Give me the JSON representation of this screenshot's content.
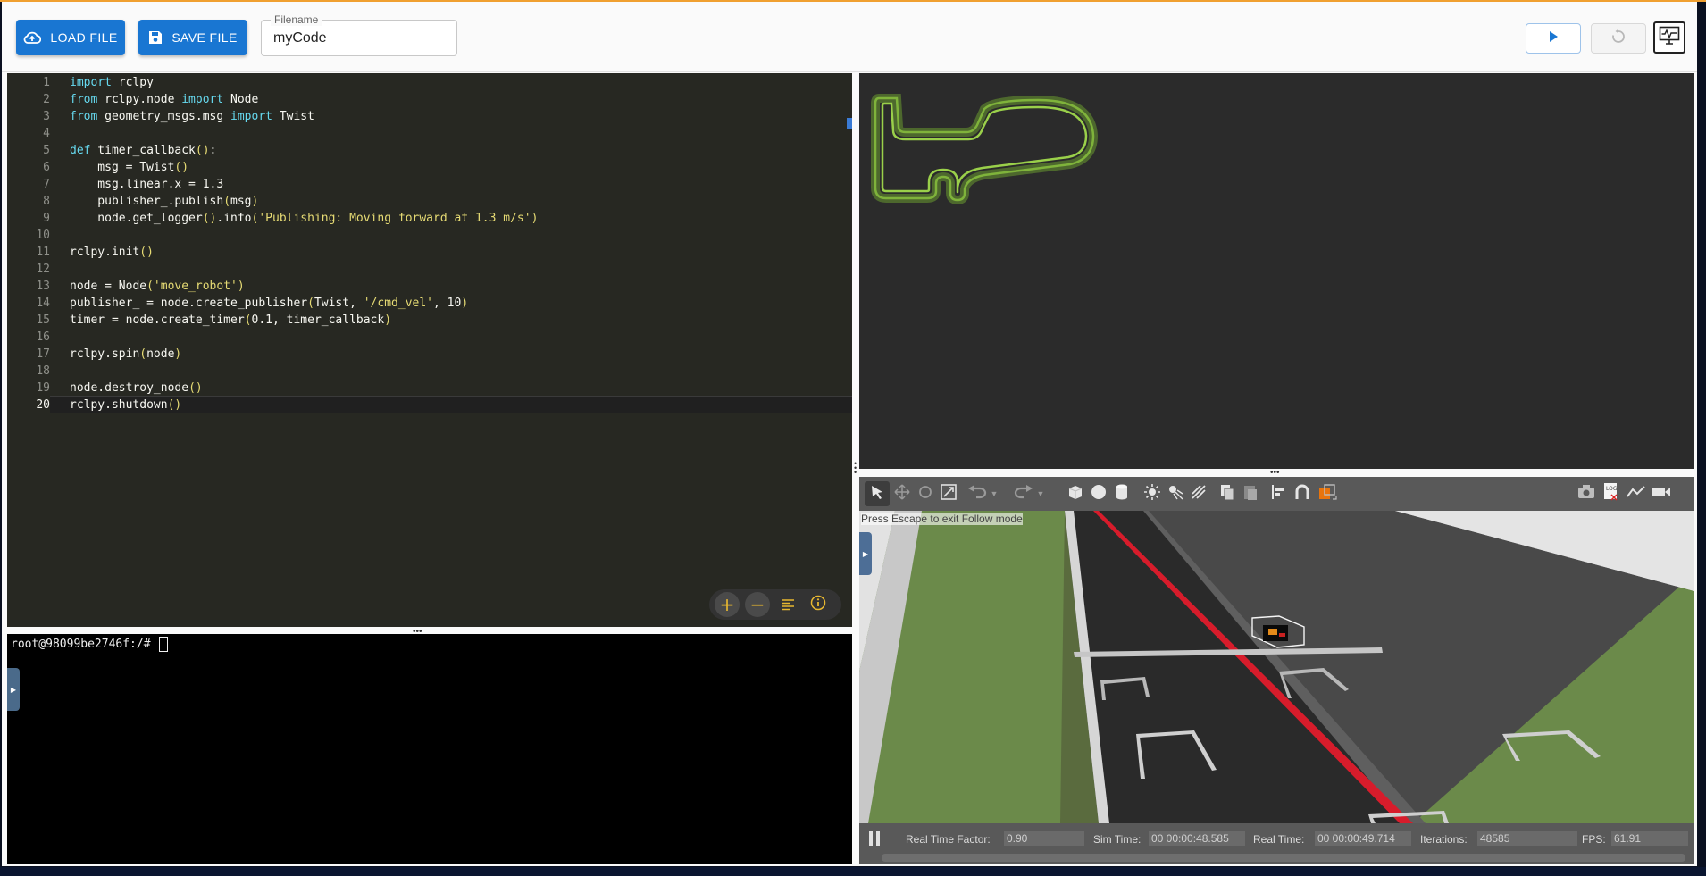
{
  "toolbar": {
    "load_label": "LOAD FILE",
    "save_label": "SAVE FILE",
    "filename_label": "Filename",
    "filename_value": "myCode"
  },
  "editor": {
    "line_numbers": [
      "1",
      "2",
      "3",
      "4",
      "5",
      "6",
      "7",
      "8",
      "9",
      "10",
      "11",
      "12",
      "13",
      "14",
      "15",
      "16",
      "17",
      "18",
      "19",
      "20"
    ],
    "active_line": 20,
    "lines": [
      [
        {
          "t": "import",
          "c": "kw"
        },
        {
          "t": " rclpy",
          "c": "tx"
        }
      ],
      [
        {
          "t": "from",
          "c": "kw"
        },
        {
          "t": " rclpy.node ",
          "c": "tx"
        },
        {
          "t": "import",
          "c": "kw"
        },
        {
          "t": " Node",
          "c": "tx"
        }
      ],
      [
        {
          "t": "from",
          "c": "kw"
        },
        {
          "t": " geometry_msgs.msg ",
          "c": "tx"
        },
        {
          "t": "import",
          "c": "kw"
        },
        {
          "t": " Twist",
          "c": "tx"
        }
      ],
      [],
      [
        {
          "t": "def",
          "c": "kw"
        },
        {
          "t": " timer_callback",
          "c": "tx"
        },
        {
          "t": "()",
          "c": "par"
        },
        {
          "t": ":",
          "c": "tx"
        }
      ],
      [
        {
          "t": "    msg = Twist",
          "c": "tx"
        },
        {
          "t": "()",
          "c": "par"
        }
      ],
      [
        {
          "t": "    msg.linear.x = ",
          "c": "tx"
        },
        {
          "t": "1.3",
          "c": "tx"
        }
      ],
      [
        {
          "t": "    publisher_.publish",
          "c": "tx"
        },
        {
          "t": "(",
          "c": "par"
        },
        {
          "t": "msg",
          "c": "tx"
        },
        {
          "t": ")",
          "c": "par"
        }
      ],
      [
        {
          "t": "    node.get_logger",
          "c": "tx"
        },
        {
          "t": "()",
          "c": "par"
        },
        {
          "t": ".info",
          "c": "tx"
        },
        {
          "t": "(",
          "c": "par"
        },
        {
          "t": "'Publishing: Moving forward at 1.3 m/s'",
          "c": "str"
        },
        {
          "t": ")",
          "c": "par"
        }
      ],
      [],
      [
        {
          "t": "rclpy.init",
          "c": "tx"
        },
        {
          "t": "()",
          "c": "par"
        }
      ],
      [],
      [
        {
          "t": "node = Node",
          "c": "tx"
        },
        {
          "t": "(",
          "c": "par"
        },
        {
          "t": "'move_robot'",
          "c": "str"
        },
        {
          "t": ")",
          "c": "par"
        }
      ],
      [
        {
          "t": "publisher_ = node.create_publisher",
          "c": "tx"
        },
        {
          "t": "(",
          "c": "par"
        },
        {
          "t": "Twist, ",
          "c": "tx"
        },
        {
          "t": "'/cmd_vel'",
          "c": "str"
        },
        {
          "t": ", ",
          "c": "tx"
        },
        {
          "t": "10",
          "c": "tx"
        },
        {
          "t": ")",
          "c": "par"
        }
      ],
      [
        {
          "t": "timer = node.create_timer",
          "c": "tx"
        },
        {
          "t": "(",
          "c": "par"
        },
        {
          "t": "0.1",
          "c": "tx"
        },
        {
          "t": ", timer_callback",
          "c": "tx"
        },
        {
          "t": ")",
          "c": "par"
        }
      ],
      [],
      [
        {
          "t": "rclpy.spin",
          "c": "tx"
        },
        {
          "t": "(",
          "c": "par"
        },
        {
          "t": "node",
          "c": "tx"
        },
        {
          "t": ")",
          "c": "par"
        }
      ],
      [],
      [
        {
          "t": "node.destroy_node",
          "c": "tx"
        },
        {
          "t": "()",
          "c": "par"
        }
      ],
      [
        {
          "t": "rclpy.shutdown",
          "c": "tx"
        },
        {
          "t": "()",
          "c": "par"
        }
      ]
    ],
    "colors": {
      "kw": "#66d9ef",
      "tx": "#f8f8f2",
      "str": "#e6db74",
      "par": "#e6db74"
    }
  },
  "terminal": {
    "prompt": "root@98099be2746f:/# "
  },
  "gazebo": {
    "hint": "Press Escape to exit Follow mode",
    "status": {
      "rtf_label": "Real Time Factor:",
      "rtf_value": "0.90",
      "sim_label": "Sim Time:",
      "sim_value": "00 00:00:48.585",
      "real_label": "Real Time:",
      "real_value": "00 00:00:49.714",
      "iter_label": "Iterations:",
      "iter_value": "48585",
      "fps_label": "FPS:",
      "fps_value": "61.91"
    }
  },
  "icons": {
    "load": "cloud-upload-icon",
    "save": "floppy-disk-icon",
    "play": "play-icon",
    "reset": "reset-icon",
    "monitor": "monitor-icon"
  },
  "colors": {
    "accent": "#1976d2",
    "editor_bg": "#272822",
    "map_bg": "#2b2b2b",
    "track_green": "#7db03a",
    "gazebo_toolbar": "#595959"
  }
}
